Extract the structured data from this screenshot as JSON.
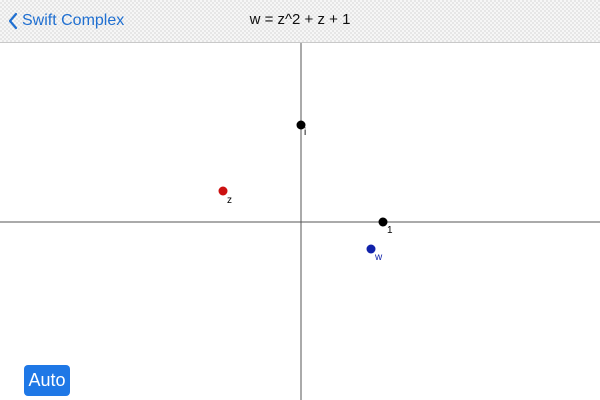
{
  "navbar": {
    "back_label": "Swift Complex",
    "title": "w = z^2 + z + 1"
  },
  "plane": {
    "points": [
      {
        "id": "i",
        "label": "i",
        "color": "#000000"
      },
      {
        "id": "one",
        "label": "1",
        "color": "#000000"
      },
      {
        "id": "z",
        "label": "z",
        "color": "#cc1111"
      },
      {
        "id": "w",
        "label": "w",
        "color": "#1122aa"
      }
    ]
  },
  "controls": {
    "auto_label": "Auto",
    "auto_color": "#1f78e6"
  }
}
